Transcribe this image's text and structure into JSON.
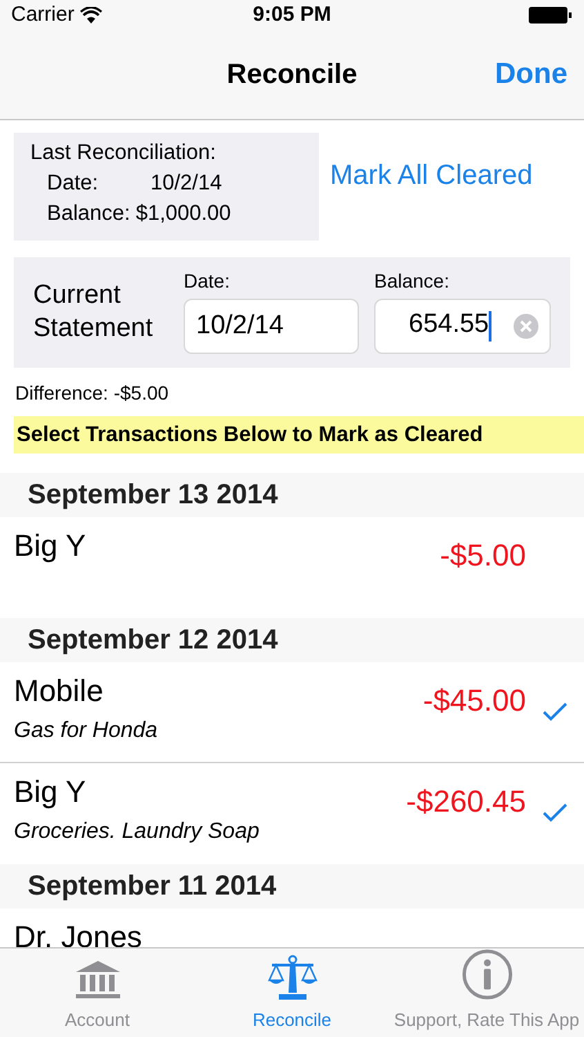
{
  "status_bar": {
    "carrier": "Carrier",
    "time": "9:05 PM"
  },
  "nav": {
    "title": "Reconcile",
    "done": "Done"
  },
  "last_reconciliation": {
    "heading": "Last Reconciliation:",
    "date_label": "Date:",
    "date": "10/2/14",
    "balance_label": "Balance:",
    "balance": "$1,000.00"
  },
  "mark_all": "Mark All Cleared",
  "current_statement": {
    "label": "Current Statement",
    "date_label": "Date:",
    "date": "10/2/14",
    "balance_label": "Balance:",
    "balance": "654.55"
  },
  "difference": "Difference: -$5.00",
  "banner": "Select Transactions Below to Mark as Cleared",
  "sections": [
    {
      "date": "September 13 2014",
      "transactions": [
        {
          "payee": "Big Y",
          "amount": "-$5.00",
          "cleared": false
        }
      ]
    },
    {
      "date": "September 12 2014",
      "transactions": [
        {
          "payee": "Mobile",
          "note": "Gas for Honda",
          "amount": "-$45.00",
          "cleared": true
        },
        {
          "payee": "Big Y",
          "note": "Groceries. Laundry Soap",
          "amount": "-$260.45",
          "cleared": true
        }
      ]
    },
    {
      "date": "September 11 2014",
      "transactions": [
        {
          "payee": "Dr. Jones"
        }
      ]
    }
  ],
  "tabs": [
    {
      "label": "Account",
      "kind": "bank",
      "selected": false
    },
    {
      "label": "Reconcile",
      "kind": "scale",
      "selected": true
    },
    {
      "label": "Support, Rate This App",
      "kind": "info",
      "selected": false
    }
  ]
}
